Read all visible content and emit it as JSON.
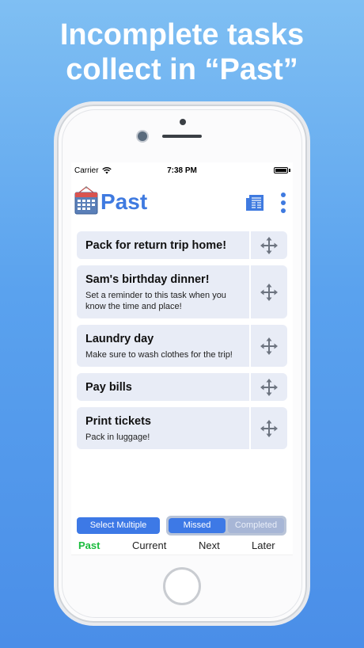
{
  "headline": {
    "line1": "Incomplete tasks",
    "line2": "collect in “Past”"
  },
  "status_bar": {
    "carrier": "Carrier",
    "time": "7:38 PM"
  },
  "header": {
    "title": "Past",
    "icons": [
      "calendar-icon",
      "newspaper-icon",
      "more-vertical-icon"
    ]
  },
  "tasks": [
    {
      "title": "Pack for return trip home!",
      "note": ""
    },
    {
      "title": "Sam's birthday dinner!",
      "note": "Set a reminder to this task when you know the time and place!"
    },
    {
      "title": "Laundry day",
      "note": "Make sure to wash clothes for the trip!"
    },
    {
      "title": "Pay bills",
      "note": ""
    },
    {
      "title": "Print tickets",
      "note": "Pack in luggage!"
    }
  ],
  "controls": {
    "select_multiple": "Select Multiple",
    "segment": {
      "missed": "Missed",
      "completed": "Completed",
      "selected": "Missed"
    }
  },
  "tabs": {
    "past": "Past",
    "current": "Current",
    "next": "Next",
    "later": "Later",
    "active": "Past"
  },
  "colors": {
    "accent": "#3f7ae0",
    "active_tab": "#1bbd3e",
    "card_bg": "#e8ecf6"
  }
}
